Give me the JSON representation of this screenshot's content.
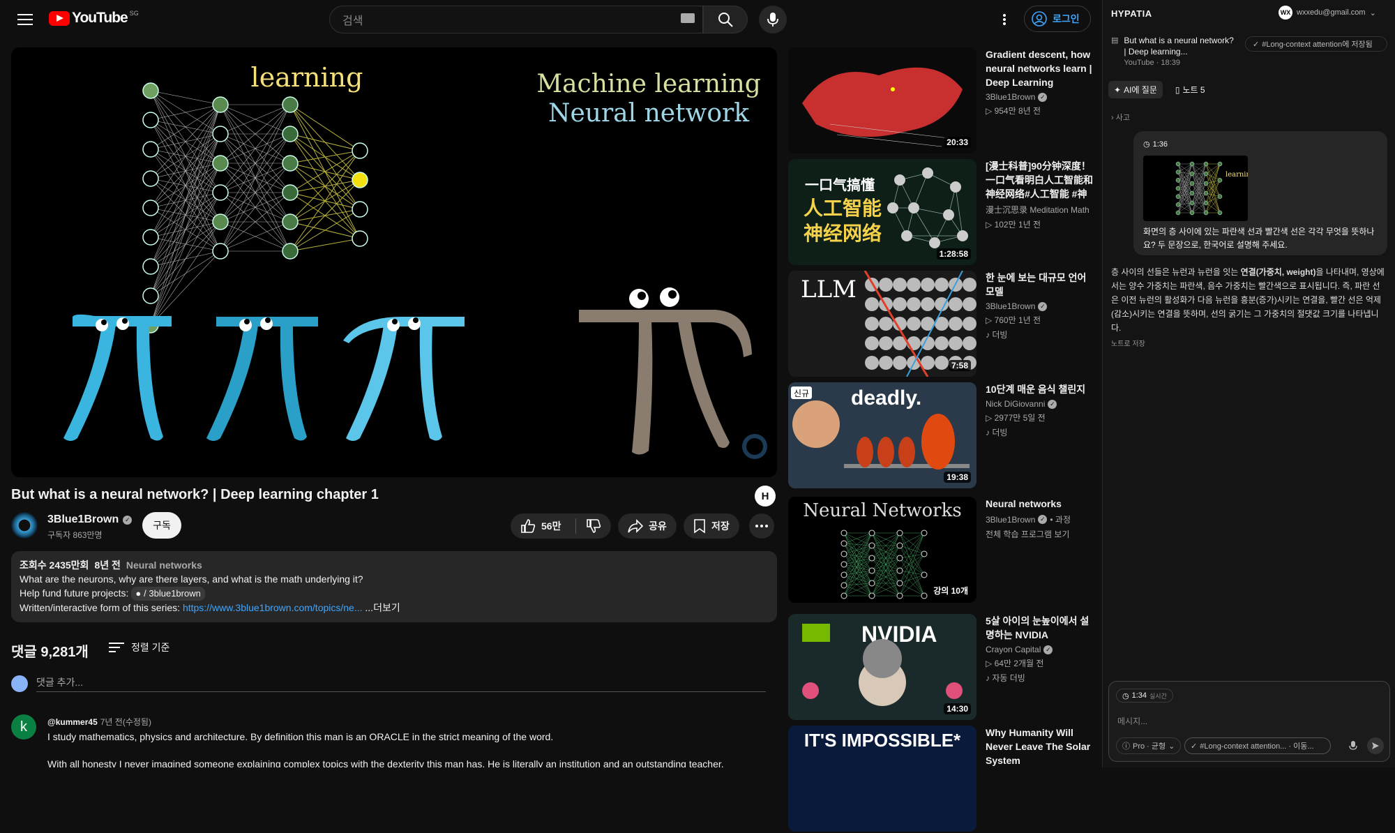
{
  "header": {
    "logo_text": "YouTube",
    "country_code": "SG",
    "search_placeholder": "검색",
    "login_label": "로그인"
  },
  "player": {
    "overlay_word": "learning",
    "overlay_title_1": "Machine learning",
    "overlay_title_2": "Neural network"
  },
  "video": {
    "title": "But what is a neural network? | Deep learning chapter 1",
    "h_badge": "H",
    "channel": "3Blue1Brown",
    "subscribers": "구독자 863만명",
    "subscribe_label": "구독",
    "likes": "56만",
    "share_label": "공유",
    "save_label": "저장"
  },
  "description": {
    "views": "조회수 2435만회",
    "age": "8년 전",
    "playlist": "Neural networks",
    "line1": "What are the neurons, why are there layers, and what is the math underlying it?",
    "line2_prefix": "Help fund future projects:",
    "line2_chip": "/ 3blue1brown",
    "line3_prefix": "Written/interactive form of this series:",
    "line3_link": "https://www.3blue1brown.com/topics/ne...",
    "more": "...더보기"
  },
  "comments": {
    "count": "댓글 9,281개",
    "sort_label": "정렬 기준",
    "add_placeholder": "댓글 추가...",
    "first": {
      "avatar_letter": "k",
      "user": "@kummer45",
      "time": "7년 전(수정됨)",
      "text": "I study mathematics, physics and architecture. By definition this man is an ORACLE in the strict meaning of the word.",
      "text2": "With all honesty I never imagined someone explaining complex topics with the dexterity this man has. He is literally an institution and an outstanding teacher."
    }
  },
  "recommendations": [
    {
      "title": "Gradient descent, how neural networks learn | Deep Learning Chapte...",
      "channel": "3Blue1Brown",
      "verified": true,
      "meta": "▷ 954만  8년 전",
      "badge": "",
      "duration": "20:33",
      "thumb": "gradient"
    },
    {
      "title": "[漫士科普]90分钟深度！一口气看明白人工智能和神经网络#人工智能 #神经网...",
      "channel": "漫士沉思录 Meditation Math",
      "verified": false,
      "meta": "▷ 102만  1년 전",
      "badge": "",
      "duration": "1:28:58",
      "thumb": "chinese",
      "thumb_text_1": "一口气搞懂",
      "thumb_text_2": "人工智能",
      "thumb_text_3": "神经网络"
    },
    {
      "title": "한 눈에 보는 대규모 언어 모델",
      "channel": "3Blue1Brown",
      "verified": true,
      "meta": "▷ 760만  1년 전",
      "badge": "더빙",
      "duration": "7:58",
      "thumb": "llm",
      "thumb_text_1": "LLM"
    },
    {
      "title": "10단계 매운 음식 챌린지",
      "channel": "Nick DiGiovanni",
      "verified": true,
      "meta": "▷ 2977만  5일 전",
      "badge": "더빙",
      "duration": "19:38",
      "thumb": "deadly",
      "thumb_text_1": "deadly.",
      "thumb_tag": "신규"
    },
    {
      "title": "Neural networks",
      "channel": "3Blue1Brown",
      "verified": true,
      "channel_suffix": "• 과정",
      "meta": "전체 학습 프로그램 보기",
      "badge": "",
      "duration": "강의 10개",
      "thumb": "nn",
      "thumb_text_1": "Neural Networks"
    },
    {
      "title": "5살 아이의 눈높이에서 설명하는 NVIDIA",
      "channel": "Crayon Capital",
      "verified": true,
      "meta": "▷ 64만  2개월 전",
      "badge": "자동 더빙",
      "duration": "14:30",
      "thumb": "nvidia",
      "thumb_text_1": "NVIDIA"
    },
    {
      "title": "Why Humanity Will Never Leave The Solar System",
      "channel": "",
      "verified": false,
      "meta": "",
      "badge": "",
      "duration": "",
      "thumb": "impossible",
      "thumb_text_1": "IT'S IMPOSSIBLE*"
    }
  ],
  "hypatia": {
    "brand": "HYPATIA",
    "account": "wxxedu@gmail.com",
    "account_initials": "WX",
    "video_title": "But what is a neural network? | Deep learning...",
    "video_meta": "YouTube · 18:39",
    "saved_label": "#Long-context attention에 저장됨",
    "tab_ask": "AI에 질문",
    "tab_notes": "노트 5",
    "thinking": "사고",
    "user_timestamp": "1:36",
    "mini_word": "learning",
    "user_question": "화면의 층 사이에 있는 파란색 선과 빨간색 선은 각각 무엇을 뜻하나요? 두 문장으로, 한국어로 설명해 주세요.",
    "answer_pre": "층 사이의 선들은 뉴런과 뉴런을 잇는 ",
    "answer_bold": "연결(가중치, weight)",
    "answer_post": "을 나타내며, 영상에서는 양수 가중치는 파란색, 음수 가중치는 빨간색으로 표시됩니다. 즉, 파란 선은 이전 뉴런의 활성화가 다음 뉴런을 흥분(증가)시키는 연결을, 빨간 선은 억제(감소)시키는 연결을 뜻하며, 선의 굵기는 그 가중치의 절댓값 크기를 나타냅니다.",
    "save_note": "노트로 저장",
    "composer_time": "1:34",
    "composer_time_suffix": "실시간",
    "composer_placeholder": "메시지...",
    "model_label": "Pro · 균형",
    "context_label": "#Long-context attention... · 이동..."
  }
}
